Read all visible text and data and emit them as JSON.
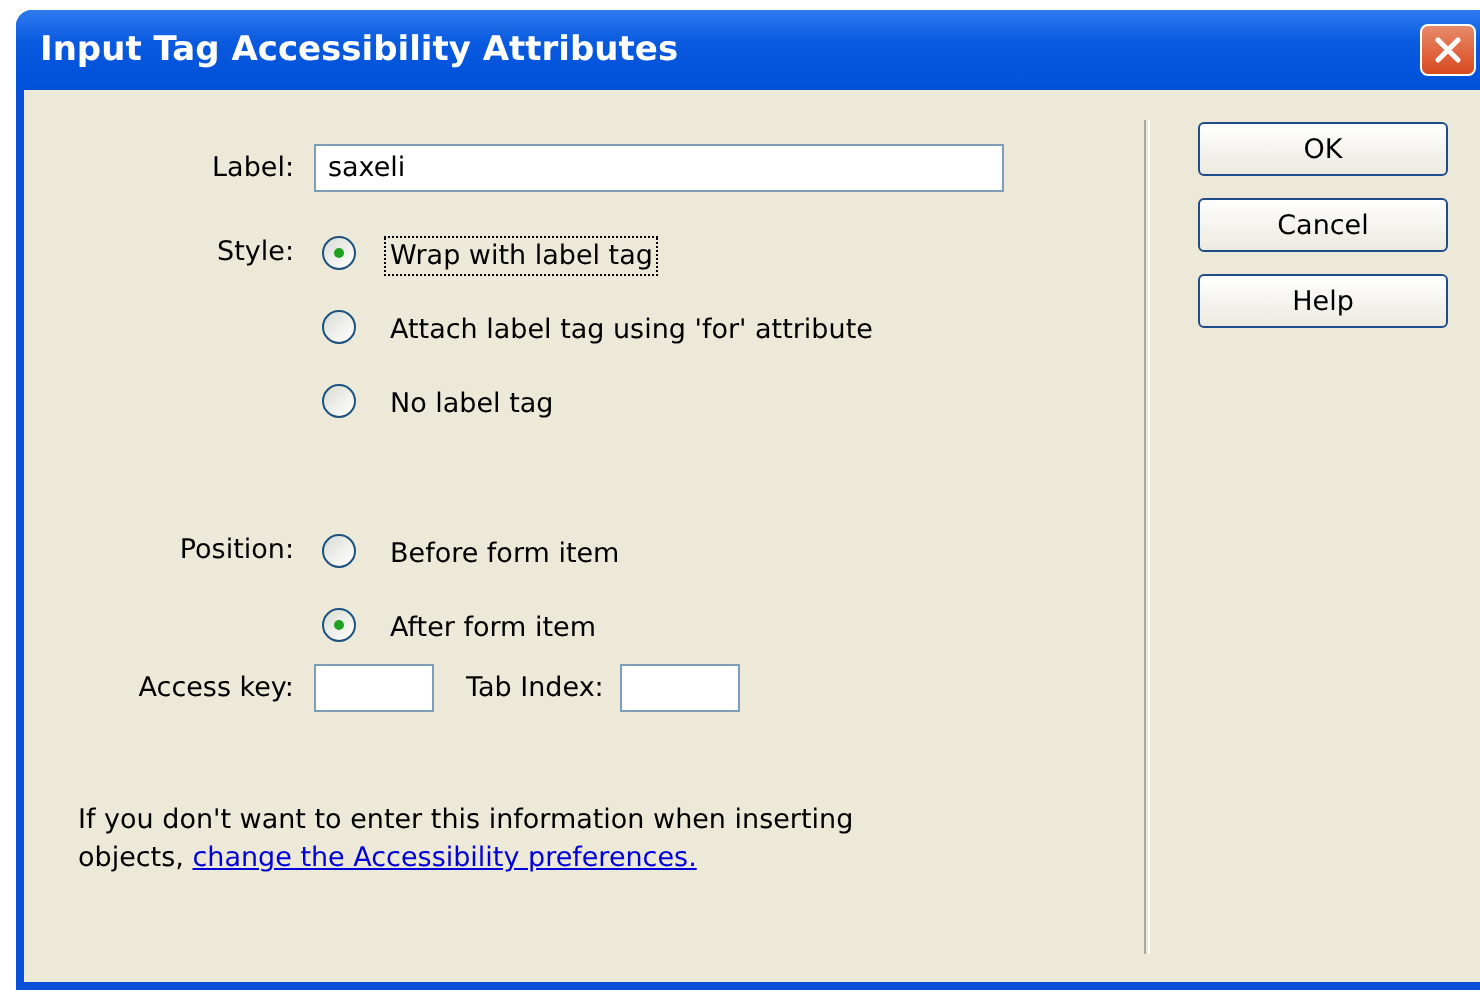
{
  "window": {
    "title": "Input Tag Accessibility Attributes"
  },
  "label_field": {
    "label": "Label:",
    "value": "saxeli"
  },
  "style": {
    "label": "Style:",
    "options": [
      {
        "label": "Wrap with label tag",
        "selected": true,
        "focused": true
      },
      {
        "label": "Attach label tag using 'for' attribute",
        "selected": false,
        "focused": false
      },
      {
        "label": "No label tag",
        "selected": false,
        "focused": false
      }
    ]
  },
  "position": {
    "label": "Position:",
    "options": [
      {
        "label": "Before form item",
        "selected": false,
        "focused": false
      },
      {
        "label": "After form item",
        "selected": true,
        "focused": false
      }
    ]
  },
  "access_key": {
    "label": "Access key:"
  },
  "tab_index": {
    "label": "Tab Index:"
  },
  "note": {
    "text": "If you don't want to enter this information when inserting objects,",
    "link": "change the Accessibility preferences."
  },
  "buttons": [
    "OK",
    "Cancel",
    "Help"
  ]
}
